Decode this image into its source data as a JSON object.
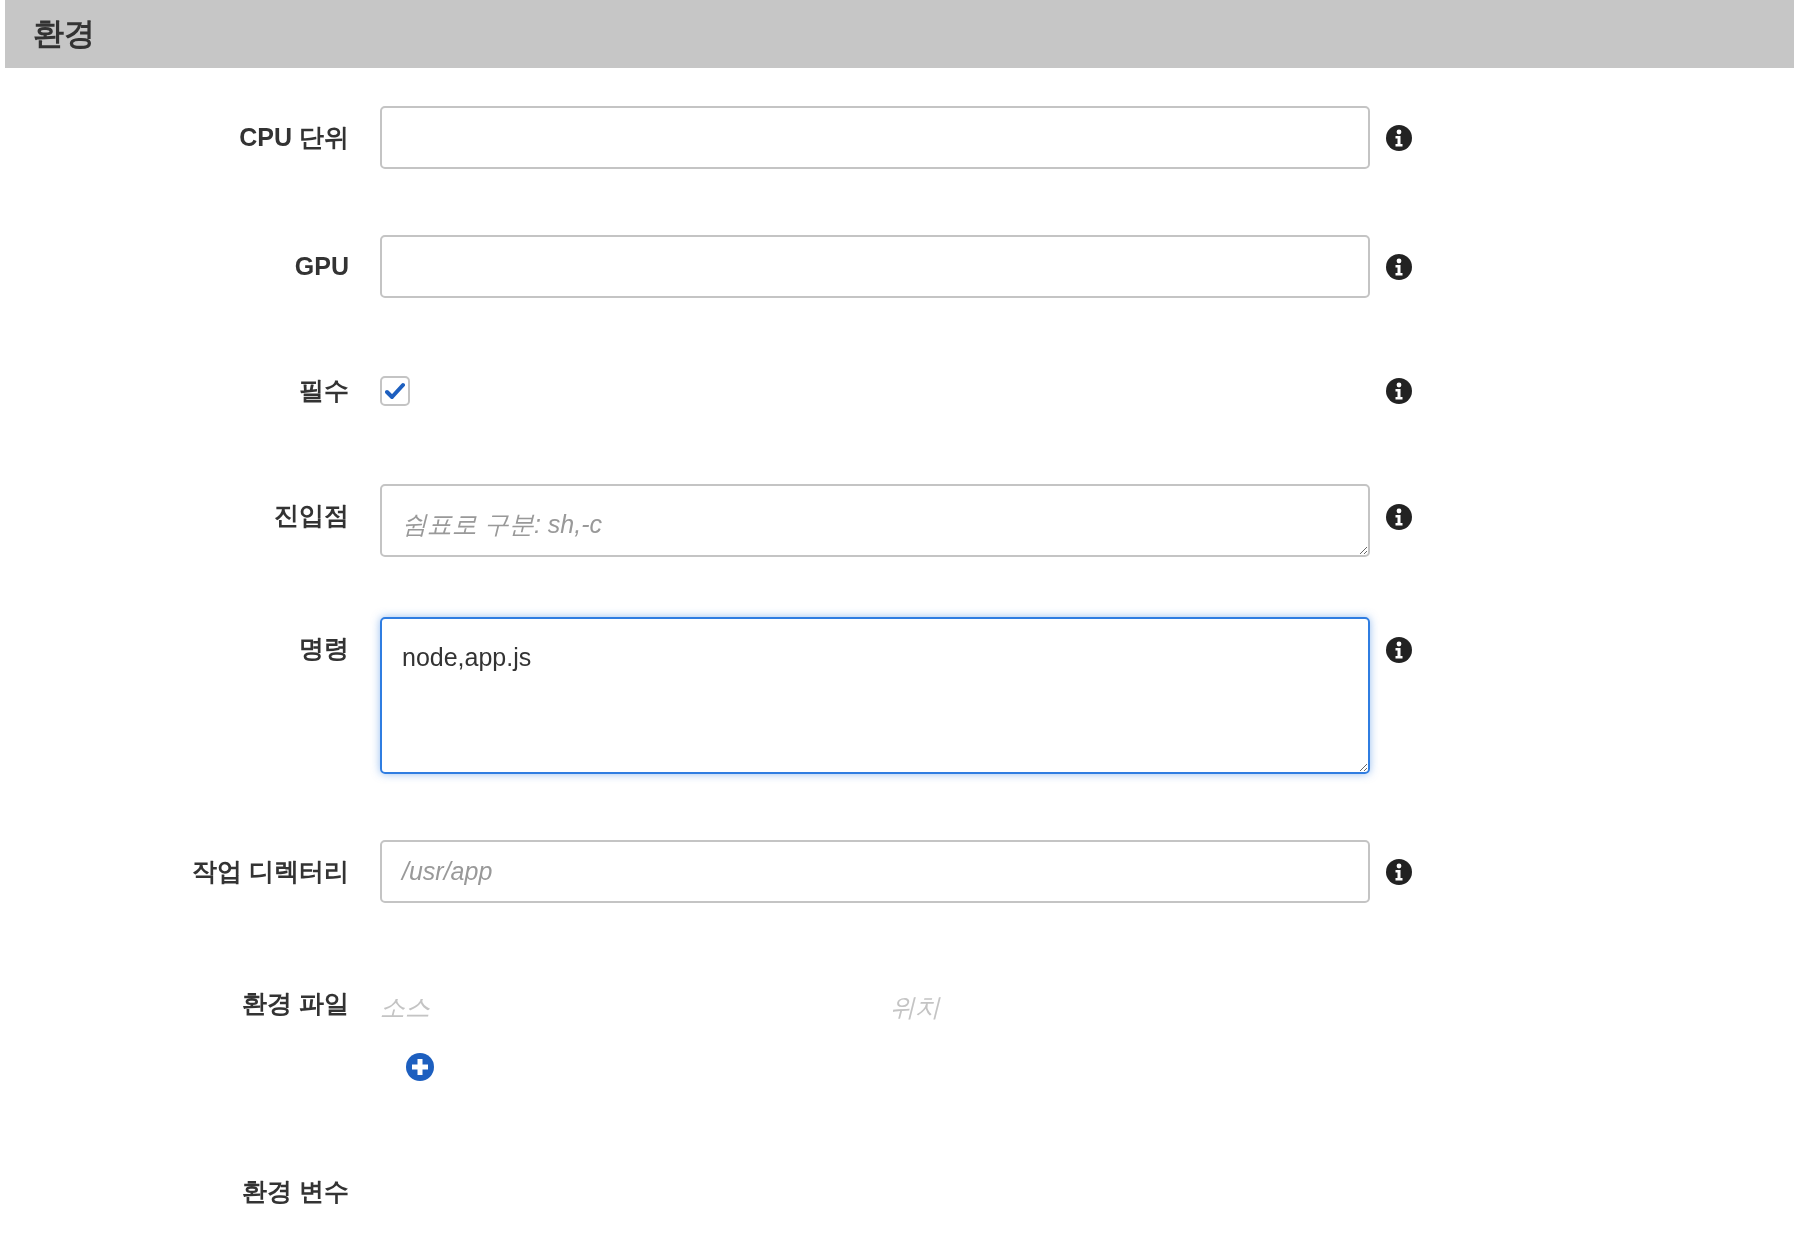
{
  "section": {
    "title": "환경"
  },
  "fields": [
    {
      "kind": "input",
      "label": "CPU 단위",
      "focused": false,
      "info": true
    },
    {
      "kind": "input",
      "label": "GPU",
      "focused": false,
      "info": true
    },
    {
      "kind": "checkbox",
      "label": "필수",
      "checked": true,
      "info": true
    },
    {
      "kind": "textarea",
      "label": "진입점",
      "placeholder": "쉼표로 구분: sh,-c",
      "focused": false,
      "info": true
    },
    {
      "kind": "textarea",
      "label": "명령",
      "value": "node,app.js",
      "focused": true,
      "info": true
    },
    {
      "kind": "input",
      "label": "작업 디렉터리",
      "placeholder": "/usr/app",
      "focused": false,
      "info": true
    },
    {
      "kind": "file_list",
      "label": "환경 파일",
      "columns": [
        "소스",
        "위치"
      ],
      "info": false
    },
    {
      "kind": "heading",
      "label": "환경 변수",
      "info": false
    }
  ]
}
